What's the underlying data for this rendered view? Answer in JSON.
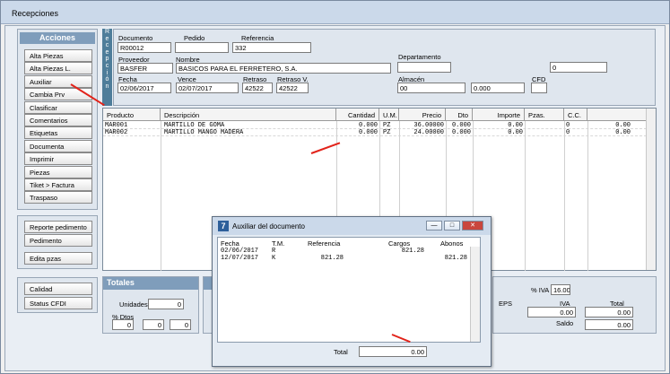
{
  "window": {
    "title": "Recepciones"
  },
  "acciones": {
    "header": "Acciones",
    "buttons": [
      "Alta Piezas",
      "Alta Piezas L.",
      "Auxiliar",
      "Cambia Prv",
      "Clasificar",
      "Comentarios",
      "Etiquetas",
      "Documenta",
      "Imprimir",
      "Piezas",
      "Tiket > Factura",
      "Traspaso"
    ],
    "extra_buttons": [
      "Reporte pedimento",
      "Pedimento",
      "Edita pzas",
      "Calidad",
      "Status CFDI"
    ]
  },
  "vertical_label": "Recepción",
  "form": {
    "documento_label": "Documento",
    "documento": "R00012",
    "pedido_label": "Pedido",
    "pedido": "",
    "referencia_label": "Referencia",
    "referencia": "332",
    "proveedor_label": "Proveedor",
    "proveedor": "BASFER",
    "nombre_label": "Nombre",
    "nombre": "BASICOS PARA EL FERRETERO, S.A.",
    "departamento_label": "Departamento",
    "departamento": "",
    "extra_value": "0",
    "fecha_label": "Fecha",
    "fecha": "02/06/2017",
    "vence_label": "Vence",
    "vence": "02/07/2017",
    "retraso_label": "Retraso",
    "retraso": "42522",
    "retraso_v_label": "Retraso V.",
    "retraso_v": "42522",
    "almacen_label": "Almacén",
    "almacen": "00",
    "almacen_extra": "",
    "almacen_amount": "0.000",
    "cfd_label": "CFD"
  },
  "grid": {
    "headers": [
      "Producto",
      "Descripción",
      "Cantidad",
      "U.M.",
      "Precio",
      "Dto",
      "Importe",
      "Pzas.",
      "C.C."
    ],
    "rows": [
      [
        "MAR001",
        "MARTILLO DE GOMA",
        "0.000",
        "PZ",
        "36.00000",
        "0.000",
        "0.00",
        "",
        "0",
        "0.00"
      ],
      [
        "MAR002",
        "MARTILLO MANGO MADERA",
        "0.000",
        "PZ",
        "24.00000",
        "0.000",
        "0.00",
        "",
        "0",
        "0.00"
      ]
    ]
  },
  "totales": {
    "header": "Totales",
    "unidades_label": "Unidades",
    "unidades": "0",
    "dtos_label": "% Dtos",
    "dtos": [
      "0",
      "0",
      "0"
    ],
    "iva_pct_label": "% IVA",
    "iva_pct": "16.00",
    "eps_label": "EPS",
    "iva_label": "IVA",
    "iva": "0.00",
    "total_label": "Total",
    "total": "0.00",
    "saldo_label": "Saldo",
    "saldo": "0.00",
    "eps_value": "0.00"
  },
  "dialog": {
    "title": "Auxiliar del documento",
    "icon_text": "7",
    "headers": [
      "Fecha",
      "T.M.",
      "Referencia",
      "Cargos",
      "Abonos"
    ],
    "rows": [
      [
        "02/06/2017",
        "R",
        "",
        "821.28",
        ""
      ],
      [
        "12/07/2017",
        "K",
        "821.28",
        "",
        "821.28"
      ]
    ],
    "total_label": "Total",
    "total": "0.00"
  },
  "colors": {
    "accent": "#7f9dbb",
    "arrow": "#e2231a"
  }
}
